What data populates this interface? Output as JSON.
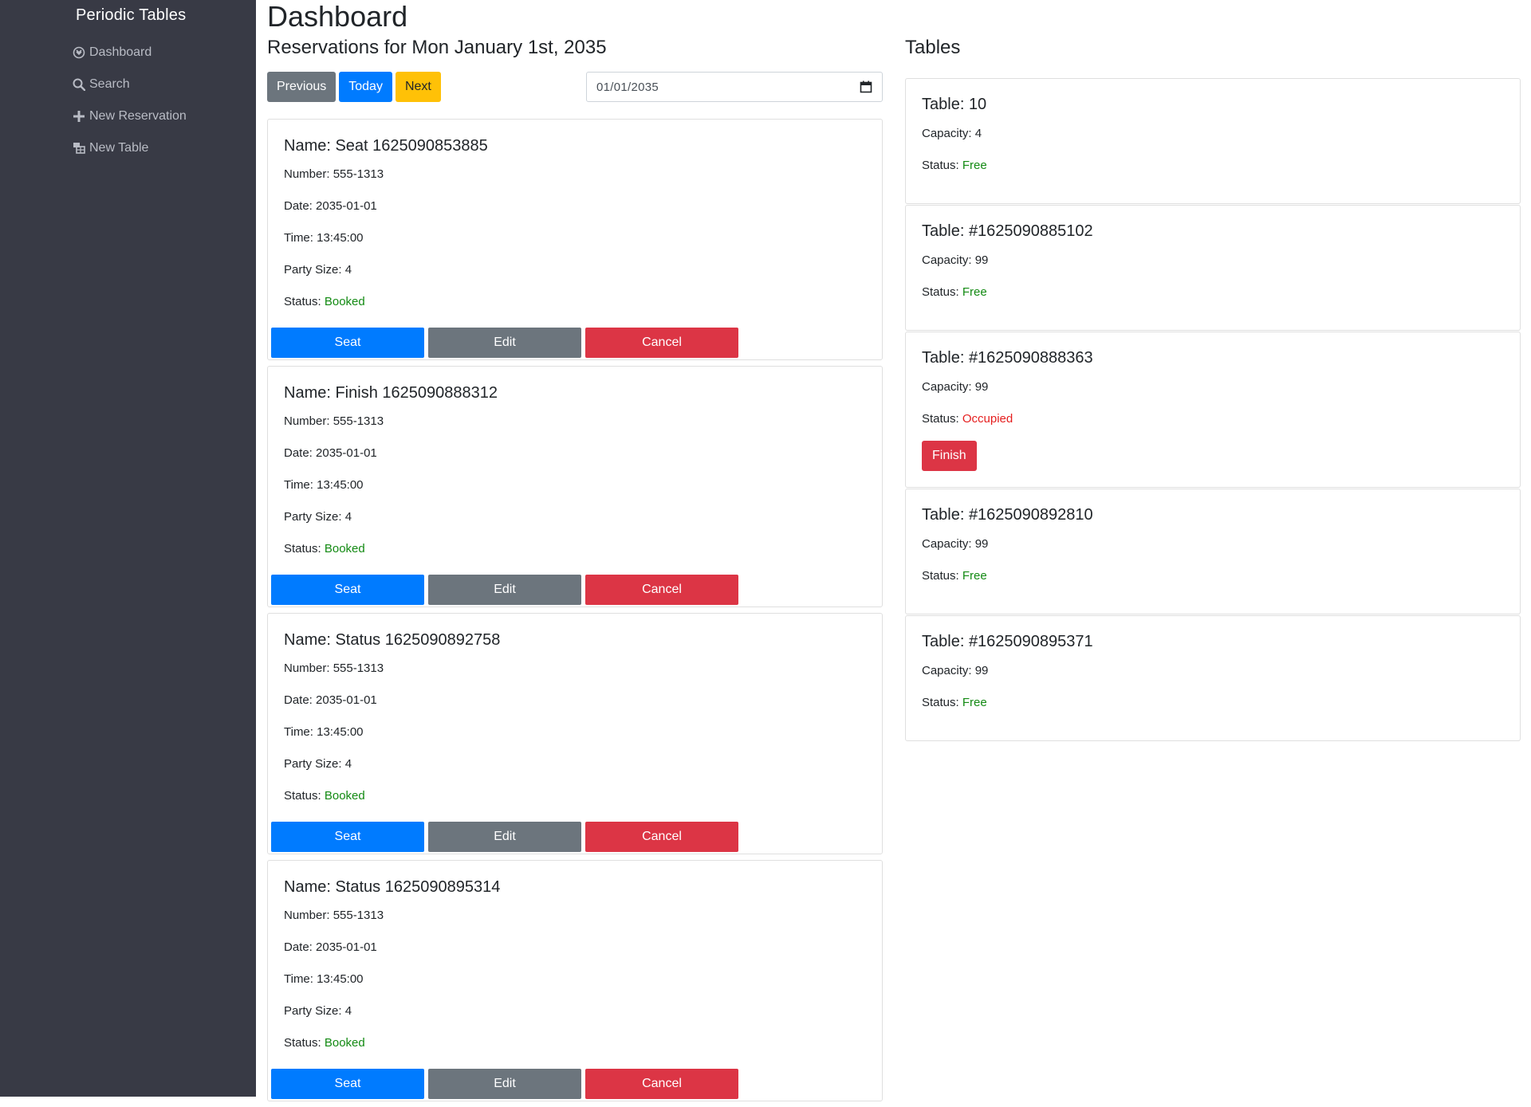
{
  "sidebar": {
    "brand": "Periodic Tables",
    "items": [
      {
        "label": "Dashboard",
        "icon": "dashboard-icon"
      },
      {
        "label": "Search",
        "icon": "search-icon"
      },
      {
        "label": "New Reservation",
        "icon": "plus-icon"
      },
      {
        "label": "New Table",
        "icon": "table-icon"
      }
    ]
  },
  "header": {
    "title": "Dashboard",
    "reservations_heading": "Reservations for Mon January 1st, 2035",
    "tables_heading": "Tables"
  },
  "day_nav": {
    "previous": "Previous",
    "today": "Today",
    "next": "Next"
  },
  "date_input": {
    "value": "01/01/2035",
    "icon": "calendar-icon"
  },
  "labels": {
    "name": "Name: ",
    "number": "Number: ",
    "date": "Date: ",
    "time": "Time: ",
    "party_size": "Party Size: ",
    "status": "Status: ",
    "table": "Table: ",
    "capacity": "Capacity: ",
    "seat": "Seat",
    "edit": "Edit",
    "cancel": "Cancel",
    "finish": "Finish"
  },
  "reservations": [
    {
      "name": "Seat 1625090853885",
      "number": "555-1313",
      "date": "2035-01-01",
      "time": "13:45:00",
      "party_size": "4",
      "status": "Booked"
    },
    {
      "name": "Finish 1625090888312",
      "number": "555-1313",
      "date": "2035-01-01",
      "time": "13:45:00",
      "party_size": "4",
      "status": "Booked"
    },
    {
      "name": "Status 1625090892758",
      "number": "555-1313",
      "date": "2035-01-01",
      "time": "13:45:00",
      "party_size": "4",
      "status": "Booked"
    },
    {
      "name": "Status 1625090895314",
      "number": "555-1313",
      "date": "2035-01-01",
      "time": "13:45:00",
      "party_size": "4",
      "status": "Booked"
    }
  ],
  "tables": [
    {
      "name": "10",
      "capacity": "4",
      "status": "Free"
    },
    {
      "name": "#1625090885102",
      "capacity": "99",
      "status": "Free"
    },
    {
      "name": "#1625090888363",
      "capacity": "99",
      "status": "Occupied"
    },
    {
      "name": "#1625090892810",
      "capacity": "99",
      "status": "Free"
    },
    {
      "name": "#1625090895371",
      "capacity": "99",
      "status": "Free"
    }
  ],
  "colors": {
    "sidebar_bg": "#383a45",
    "primary": "#007bff",
    "secondary": "#6c757d",
    "warning": "#ffc107",
    "danger": "#dc3545",
    "status_ok": "#138a13",
    "status_occupied": "#e51e1e"
  }
}
